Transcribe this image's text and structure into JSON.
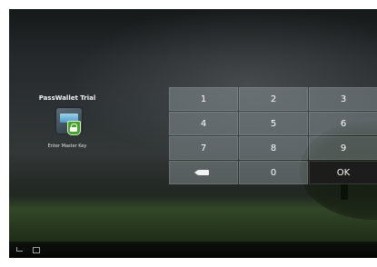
{
  "app_shortcut": {
    "title": "PassWallet Trial",
    "caption": "Enter Master Key",
    "icon": "wallet-lock-icon"
  },
  "keypad": {
    "keys": [
      "1",
      "2",
      "3",
      "4",
      "5",
      "6",
      "7",
      "8",
      "9",
      "backspace",
      "0",
      "OK"
    ],
    "k1": "1",
    "k2": "2",
    "k3": "3",
    "k4": "4",
    "k5": "5",
    "k6": "6",
    "k7": "7",
    "k8": "8",
    "k9": "9",
    "k0": "0",
    "ok": "OK",
    "backspace_icon": "backspace-icon"
  },
  "colors": {
    "key_background": "#a0aab0",
    "ok_key_background": "#1c1c1c",
    "lock_badge": "#48a02d",
    "status_accent": "#3d8fd6"
  }
}
